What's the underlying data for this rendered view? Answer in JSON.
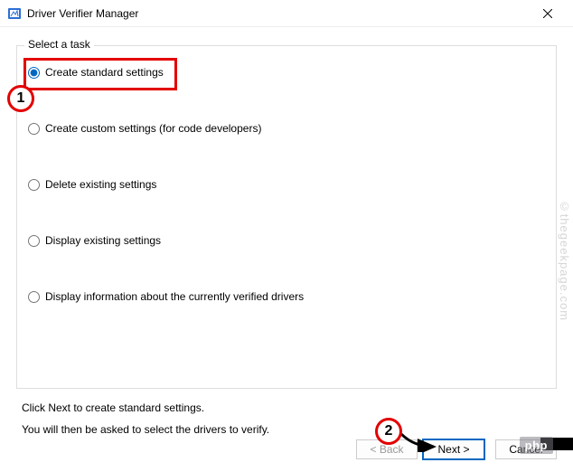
{
  "window": {
    "title": "Driver Verifier Manager"
  },
  "group": {
    "label": "Select a task",
    "options": {
      "o1": "Create standard settings",
      "o2": "Create custom settings (for code developers)",
      "o3": "Delete existing settings",
      "o4": "Display existing settings",
      "o5": "Display information about the currently verified drivers"
    }
  },
  "instructions": {
    "line1": "Click Next to create standard settings.",
    "line2": "You will then be asked to select the drivers to verify."
  },
  "buttons": {
    "back": "< Back",
    "next": "Next >",
    "cancel": "Cancel"
  },
  "annotations": {
    "n1": "1",
    "n2": "2"
  },
  "watermark": {
    "text": "©thegeekpage.com",
    "badge": "php"
  }
}
